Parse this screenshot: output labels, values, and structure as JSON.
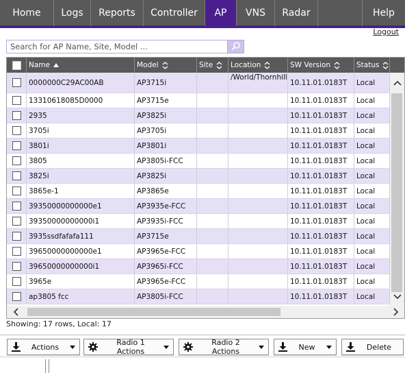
{
  "nav": {
    "tabs": [
      {
        "label": "Home",
        "active": false
      },
      {
        "label": "Logs",
        "active": false
      },
      {
        "label": "Reports",
        "active": false
      },
      {
        "label": "Controller",
        "active": false
      },
      {
        "label": "AP",
        "active": true
      },
      {
        "label": "VNS",
        "active": false
      },
      {
        "label": "Radar",
        "active": false
      }
    ],
    "help_label": "Help",
    "accent_color": "#4b1e8e"
  },
  "logout_label": "Logout",
  "search": {
    "placeholder": "Search for AP Name, Site, Model ...",
    "value": "",
    "icon": "search-icon"
  },
  "table": {
    "columns": [
      {
        "label": "",
        "key": "select"
      },
      {
        "label": "Name",
        "sort": "asc"
      },
      {
        "label": "Model",
        "sort": "both"
      },
      {
        "label": "Site",
        "sort": "both"
      },
      {
        "label": "Location",
        "sort": "both"
      },
      {
        "label": "SW Version",
        "sort": "both"
      },
      {
        "label": "Status",
        "sort": "both"
      }
    ],
    "rows": [
      {
        "name": "0000000C29AC00AB",
        "model": "AP3715i",
        "site": "",
        "location": "/World/Thornhill",
        "sw": "10.11.01.0183T",
        "status": "Local"
      },
      {
        "name": "13310618085D0000",
        "model": "AP3715e",
        "site": "",
        "location": "",
        "sw": "10.11.01.0183T",
        "status": "Local"
      },
      {
        "name": "2935",
        "model": "AP3825i",
        "site": "",
        "location": "",
        "sw": "10.11.01.0183T",
        "status": "Local"
      },
      {
        "name": "3705i",
        "model": "AP3705i",
        "site": "",
        "location": "",
        "sw": "10.11.01.0183T",
        "status": "Local"
      },
      {
        "name": "3801i",
        "model": "AP3801i",
        "site": "",
        "location": "",
        "sw": "10.11.01.0183T",
        "status": "Local"
      },
      {
        "name": "3805",
        "model": "AP3805i-FCC",
        "site": "",
        "location": "",
        "sw": "10.11.01.0183T",
        "status": "Local"
      },
      {
        "name": "3825i",
        "model": "AP3825i",
        "site": "",
        "location": "",
        "sw": "10.11.01.0183T",
        "status": "Local"
      },
      {
        "name": "3865e-1",
        "model": "AP3865e",
        "site": "",
        "location": "",
        "sw": "10.11.01.0183T",
        "status": "Local"
      },
      {
        "name": "39350000000000e1",
        "model": "AP3935e-FCC",
        "site": "",
        "location": "",
        "sw": "10.11.01.0183T",
        "status": "Local"
      },
      {
        "name": "39350000000000i1",
        "model": "AP3935i-FCC",
        "site": "",
        "location": "",
        "sw": "10.11.01.0183T",
        "status": "Local"
      },
      {
        "name": "3935ssdfafafa111",
        "model": "AP3715e",
        "site": "",
        "location": "",
        "sw": "10.11.01.0183T",
        "status": "Local"
      },
      {
        "name": "39650000000000e1",
        "model": "AP3965e-FCC",
        "site": "",
        "location": "",
        "sw": "10.11.01.0183T",
        "status": "Local"
      },
      {
        "name": "39650000000000i1",
        "model": "AP3965i-FCC",
        "site": "",
        "location": "",
        "sw": "10.11.01.0183T",
        "status": "Local"
      },
      {
        "name": "3965e",
        "model": "AP3965e-FCC",
        "site": "",
        "location": "",
        "sw": "10.11.01.0183T",
        "status": "Local"
      },
      {
        "name": "ap3805 fcc",
        "model": "AP3805i-FCC",
        "site": "",
        "location": "",
        "sw": "10.11.01.0183T",
        "status": "Local"
      }
    ]
  },
  "status_line": "Showing: 17 rows, Local: 17",
  "toolbar": {
    "actions_label": "Actions",
    "radio1_label": "Radio 1 Actions",
    "radio2_label": "Radio 2 Actions",
    "new_label": "New",
    "delete_label": "Delete"
  }
}
